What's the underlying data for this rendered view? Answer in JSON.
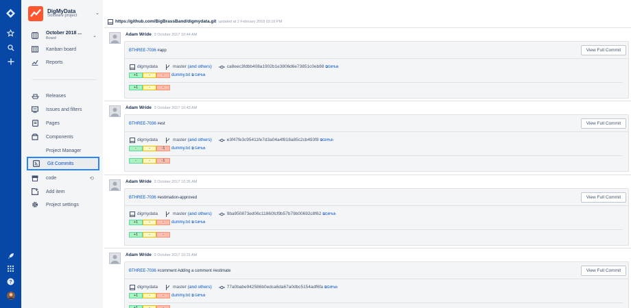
{
  "project": {
    "name": "DigMyData",
    "type": "Software project"
  },
  "nav": {
    "board": {
      "label": "October 2018 ...",
      "sub": "Board"
    },
    "kanban": "Kanban board",
    "reports": "Reports",
    "releases": "Releases",
    "issues": "Issues and filters",
    "pages": "Pages",
    "components": "Components",
    "project_manager": "Project Manager",
    "git_commits": "Git Commits",
    "code": "code",
    "add_item": "Add item",
    "settings": "Project settings"
  },
  "repo": {
    "url": "https://github.com/BigBrassBand/digmydata.git",
    "updated": "updated at 2 February 2018 02:16 PM"
  },
  "labels": {
    "view_full_commit": "View Full Commit",
    "and_others": "(and others)",
    "github": "GitHub"
  },
  "commits": [
    {
      "author": "Adam Wride",
      "date": "3 October 2017 10:44 AM",
      "key": "BTHREE-7036",
      "message": "#app",
      "repo": "digmydata",
      "branch": "master",
      "hash": "ca8eec3fdbb408a1902b1e3806d6e73851c0eb88",
      "file": {
        "name": "dummy.txt",
        "add": "+1",
        "mod": "-",
        "del": "-"
      },
      "total": {
        "add": "+1",
        "mod": "-",
        "del": "-"
      }
    },
    {
      "author": "Adam Wride",
      "date": "3 October 2017 10:43 AM",
      "key": "BTHREE-7036",
      "message": "#est",
      "repo": "digmydata",
      "branch": "master",
      "hash": "e3f47fe3c95411fe7d3a04a4f818a85c2cb493f8",
      "file": {
        "name": "dummy.txt",
        "add": "-",
        "mod": "-",
        "del": "-1"
      },
      "total": {
        "add": "-",
        "mod": "-",
        "del": "-1"
      }
    },
    {
      "author": "Adam Wride",
      "date": "3 October 2017 10:35 AM",
      "key": "BTHREE-7036",
      "message": "#estimation-approved",
      "repo": "digmydata",
      "branch": "master",
      "hash": "9ba950873ed06c11860fcf9b57b79b00692c8f62",
      "file": {
        "name": "dummy.txt",
        "add": "+1",
        "mod": "-",
        "del": "-"
      },
      "total": {
        "add": "+1",
        "mod": "-",
        "del": "-"
      }
    },
    {
      "author": "Adam Wride",
      "date": "3 October 2017 10:31 AM",
      "key": "BTHREE-7036",
      "message": "#comment Adding a comment #estimate",
      "repo": "digmydata",
      "branch": "master",
      "hash": "77a0babe942586b0edca6da67a0dbc5154adf6fa",
      "file": {
        "name": "dummy.txt",
        "add": "+1",
        "mod": "-",
        "del": "-"
      },
      "total": {
        "add": "+1",
        "mod": "-",
        "del": "-"
      }
    }
  ]
}
